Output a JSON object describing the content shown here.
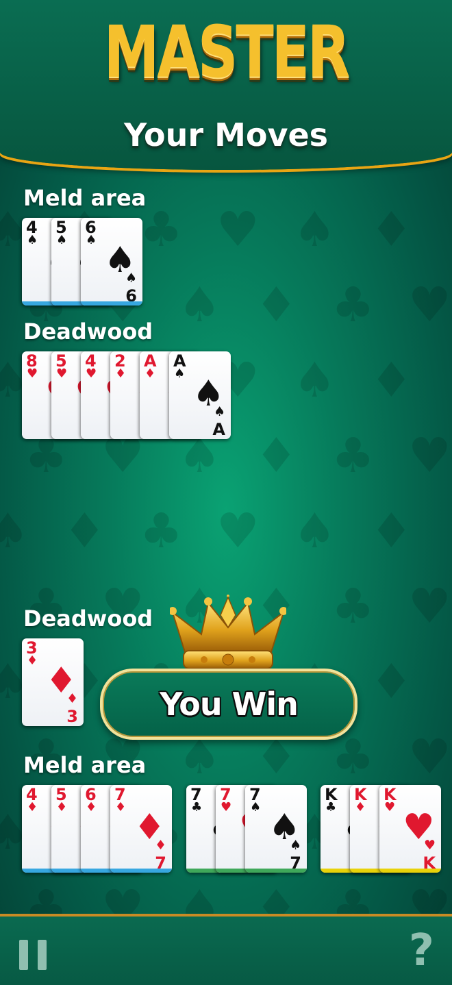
{
  "header": {
    "title": "MASTER",
    "subtitle": "Your Moves"
  },
  "opponent": {
    "meld_label": "Meld area",
    "meld_cards": [
      {
        "rank": "4",
        "suit": "♠",
        "color": "black"
      },
      {
        "rank": "5",
        "suit": "♠",
        "color": "black"
      },
      {
        "rank": "6",
        "suit": "♠",
        "color": "black"
      }
    ],
    "deadwood_label": "Deadwood",
    "deadwood_cards": [
      {
        "rank": "8",
        "suit": "♥",
        "color": "red"
      },
      {
        "rank": "5",
        "suit": "♥",
        "color": "red"
      },
      {
        "rank": "4",
        "suit": "♥",
        "color": "red"
      },
      {
        "rank": "2",
        "suit": "♦",
        "color": "red"
      },
      {
        "rank": "A",
        "suit": "♦",
        "color": "red"
      },
      {
        "rank": "A",
        "suit": "♠",
        "color": "black"
      }
    ]
  },
  "player": {
    "deadwood_label": "Deadwood",
    "deadwood_card": {
      "rank": "3",
      "suit": "♦",
      "color": "red"
    },
    "result": "You Win",
    "meld_label": "Meld area",
    "meld_groups": [
      {
        "stripe": "#37a7e0",
        "cards": [
          {
            "rank": "4",
            "suit": "♦",
            "color": "red"
          },
          {
            "rank": "5",
            "suit": "♦",
            "color": "red"
          },
          {
            "rank": "6",
            "suit": "♦",
            "color": "red"
          },
          {
            "rank": "7",
            "suit": "♦",
            "color": "red"
          }
        ]
      },
      {
        "stripe": "#3fa85a",
        "cards": [
          {
            "rank": "7",
            "suit": "♣",
            "color": "black"
          },
          {
            "rank": "7",
            "suit": "♥",
            "color": "red"
          },
          {
            "rank": "7",
            "suit": "♠",
            "color": "black"
          }
        ]
      },
      {
        "stripe": "#e8d20a",
        "cards": [
          {
            "rank": "K",
            "suit": "♣",
            "color": "black"
          },
          {
            "rank": "K",
            "suit": "♦",
            "color": "red"
          },
          {
            "rank": "K",
            "suit": "♥",
            "color": "red"
          }
        ]
      }
    ]
  },
  "meld_stripe_color": "#37a7e0",
  "footer": {
    "pause_icon": "pause-icon",
    "help_symbol": "?"
  }
}
